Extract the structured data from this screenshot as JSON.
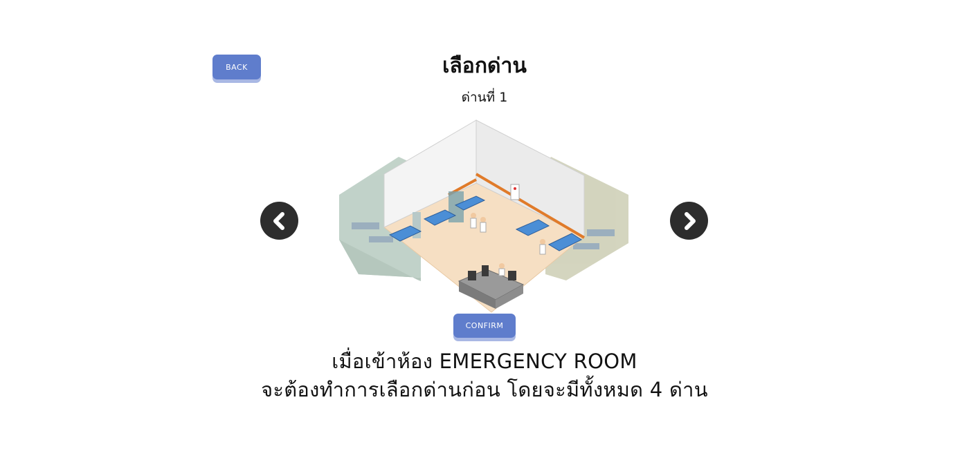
{
  "header": {
    "back_label": "BACK",
    "title": "เลือกด่าน",
    "stage_label": "ด่านที่ 1"
  },
  "carousel": {
    "prev_icon": "chevron-left-icon",
    "next_icon": "chevron-right-icon"
  },
  "actions": {
    "confirm_label": "CONFIRM"
  },
  "description": {
    "line1": "เมื่อเข้าห้อง EMERGENCY ROOM",
    "line2": "จะต้องทำการเลือกด่านก่อน โดยจะมีทั้งหมด 4 ด่าน"
  },
  "colors": {
    "button": "#5f7dcc",
    "button_shadow": "#a9b8e4",
    "arrow": "#2d2d2d",
    "floor": "#f6dfc3"
  }
}
